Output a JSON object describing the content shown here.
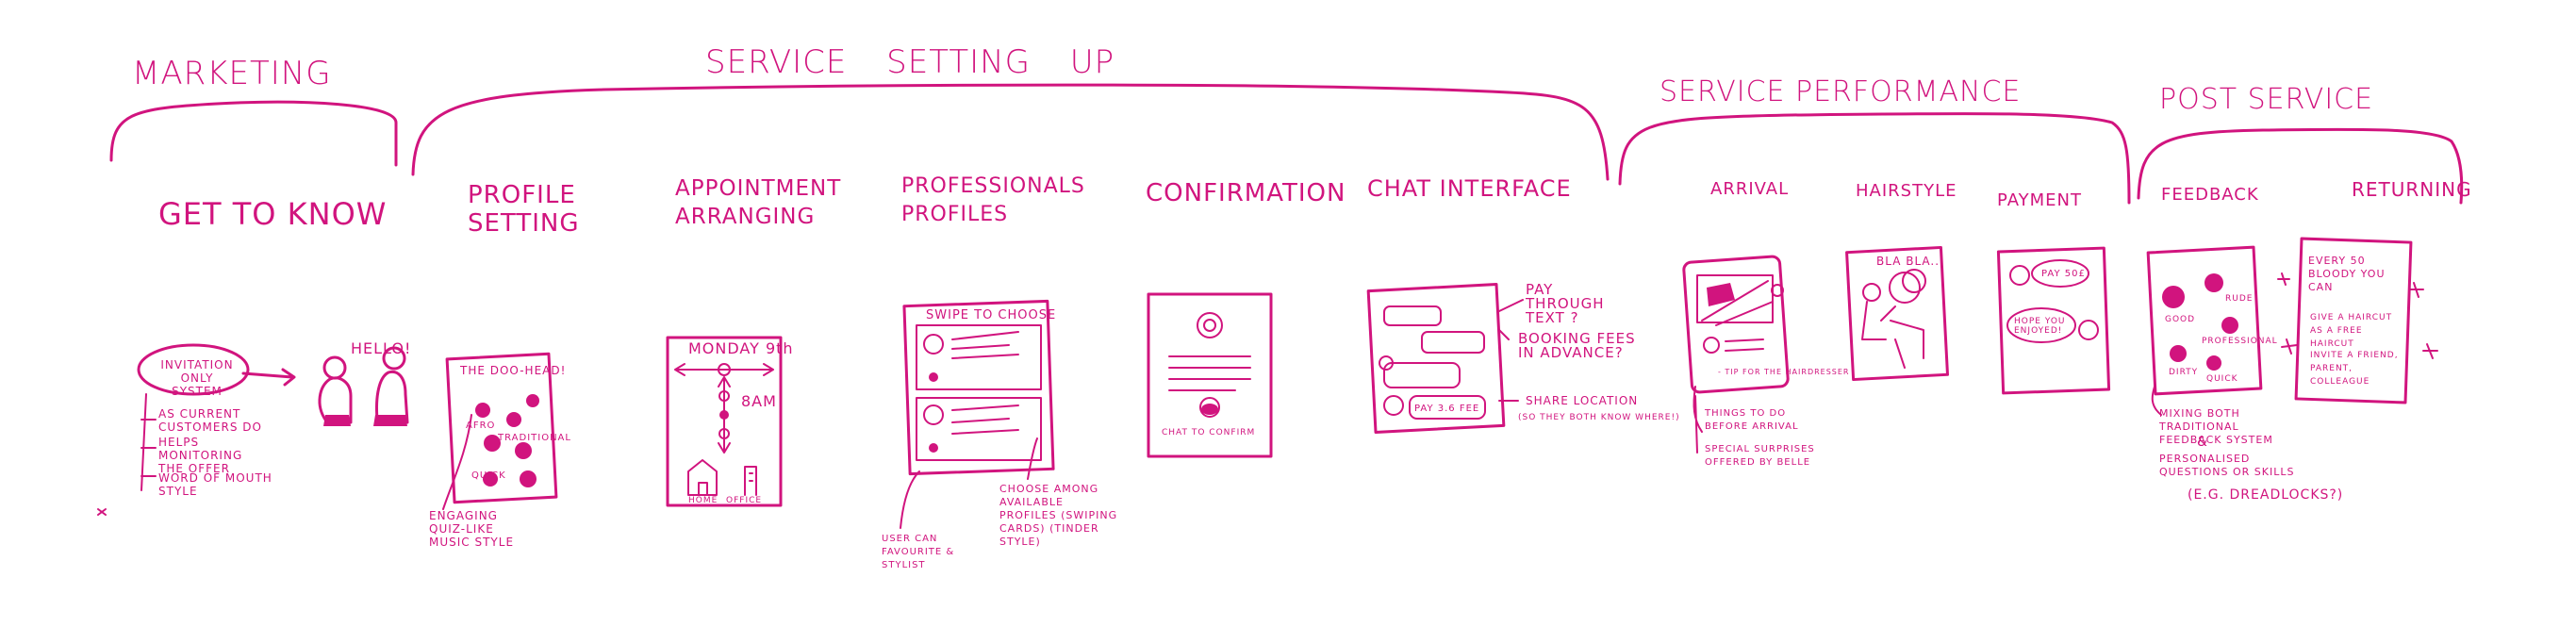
{
  "phases": {
    "marketing": "MARKETING",
    "service_setting_up": "SERVICE SETTING UP",
    "service_performance": "SERVICE PERFORMANCE",
    "post_service": "POST SERVICE"
  },
  "stages": {
    "get_to_know": "GET TO KNOW",
    "profile_setting": "PROFILE SETTING",
    "appointment_arranging": "APPOINTMENT ARRANGING",
    "professionals_profiles": "PROFESSIONALS PROFILES",
    "confirmation": "CONFIRMATION",
    "chat_interface": "CHAT INTERFACE",
    "arrival": "ARRIVAL",
    "hairstyle": "HAIRSTYLE",
    "payment": "PAYMENT",
    "feedback": "FEEDBACK",
    "returning": "RETURNING"
  },
  "get_to_know": {
    "bubble": "INVITATION ONLY SYSTEM",
    "greeting": "HELLO!",
    "notes": [
      "AS CURRENT CUSTOMERS DO",
      "HELPS MONITORING THE OFFER",
      "WORD OF MOUTH STYLE"
    ]
  },
  "profile_setting": {
    "screen_title": "THE DOO-HEAD!",
    "bubbles": [
      "AFRO",
      "TRADITIONAL",
      "QUICK"
    ],
    "note": "ENGAGING QUIZ-LIKE MUSIC STYLE"
  },
  "appointment": {
    "day": "MONDAY 9th",
    "time": "8AM",
    "home": "HOME",
    "office": "OFFICE"
  },
  "professionals": {
    "screen_title": "SWIPE TO CHOOSE",
    "notes_left": "USER CAN FAVOURITE & STYLIST",
    "notes_right": "CHOOSE AMONG AVAILABLE PROFILES (SWIPING CARDS) (TINDER STYLE)"
  },
  "confirmation": {
    "button": "CHAT TO CONFIRM"
  },
  "chat": {
    "chat_row": "PAY 3.6 FEE",
    "note_pay": "PAY THROUGH TEXT ?",
    "note_booking": "BOOKING FEES IN ADVANCE?",
    "note_location": "SHARE LOCATION",
    "note_location_sub": "(SO THEY BOTH KNOW WHERE!)"
  },
  "arrival": {
    "screen_line": "- TIP FOR THE HAIRDRESSER",
    "notes": [
      "THINGS TO DO BEFORE ARRIVAL",
      "SPECIAL SURPRISES OFFERED BY BELLE"
    ]
  },
  "hairstyle": {
    "speech": "BLA BLA..."
  },
  "payment": {
    "bubble_1": "PAY 50£",
    "bubble_2": "HOPE YOU ENJOYED!"
  },
  "feedback": {
    "bubbles": [
      "GOOD",
      "RUDE",
      "PROFESSIONAL",
      "QUICK",
      "DIRTY"
    ],
    "note_1": "MIXING BOTH TRADITIONAL FEEDBACK SYSTEM",
    "note_amp": "&",
    "note_2": "PERSONALISED QUESTIONS OR SKILLS",
    "note_3": "(E.G. DREADLOCKS?)"
  },
  "returning": {
    "text_1": "EVERY 50 BLOODY YOU CAN",
    "bullets": [
      "GIVE A HAIRCUT AS A FREE HAIRCUT",
      "INVITE A FRIEND, PARENT, COLLEAGUE"
    ]
  },
  "colors": {
    "ink": "#d1147e",
    "paper": "#ffffff"
  }
}
